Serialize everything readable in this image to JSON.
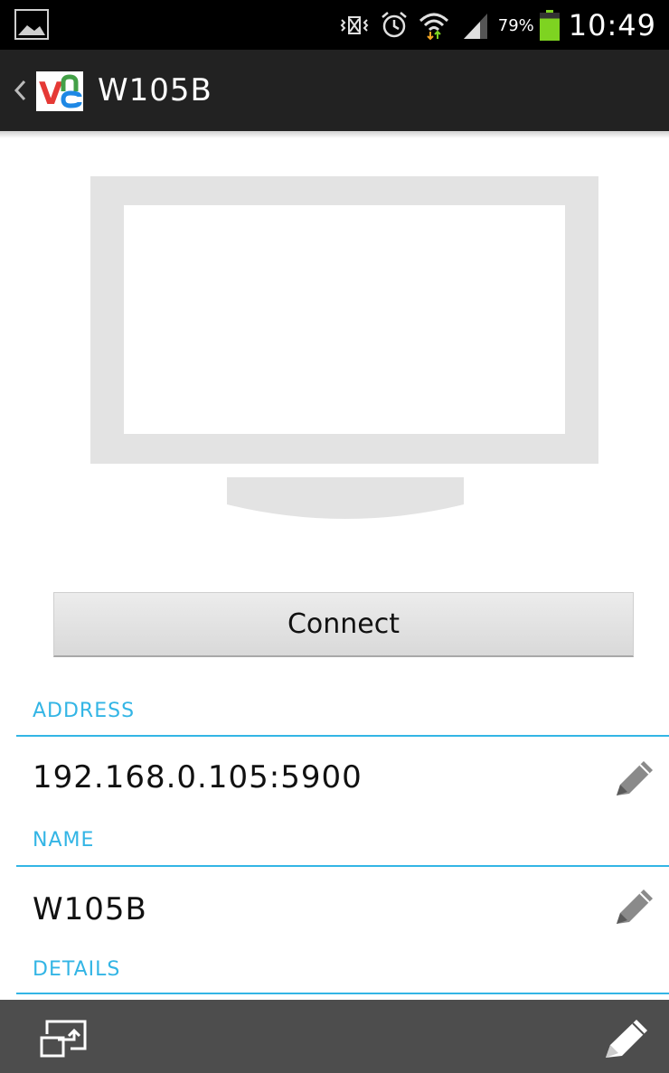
{
  "status_bar": {
    "battery_percent": "79%",
    "battery_level": 0.79,
    "time": "10:49",
    "icons": [
      "gallery-icon",
      "vibrate-icon",
      "alarm-icon",
      "wifi-icon",
      "signal-icon",
      "battery-icon"
    ]
  },
  "action_bar": {
    "title": "W105B",
    "app_logo": "vnc-logo-icon"
  },
  "connect_button": {
    "label": "Connect"
  },
  "sections": {
    "address": {
      "label": "ADDRESS",
      "value": "192.168.0.105:5900"
    },
    "name": {
      "label": "NAME",
      "value": "W105B"
    },
    "details": {
      "label": "DETAILS"
    }
  },
  "bottom_bar": {
    "left_icon": "switch-window-icon",
    "right_icon": "pencil-icon"
  },
  "colors": {
    "accent": "#33b5e5",
    "action_bar_bg": "#222222",
    "bottom_bar_bg": "#4d4d4d",
    "battery": "#7ed321"
  }
}
